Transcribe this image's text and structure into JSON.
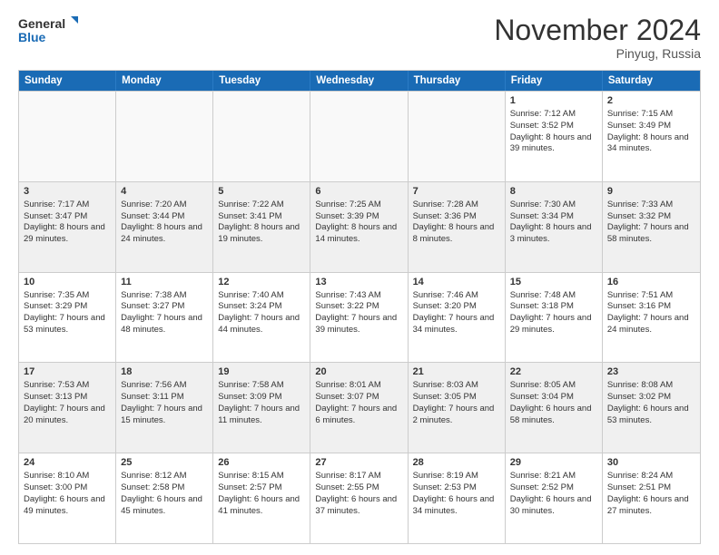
{
  "logo": {
    "line1": "General",
    "line2": "Blue"
  },
  "title": "November 2024",
  "location": "Pinyug, Russia",
  "headers": [
    "Sunday",
    "Monday",
    "Tuesday",
    "Wednesday",
    "Thursday",
    "Friday",
    "Saturday"
  ],
  "rows": [
    [
      {
        "day": "",
        "content": ""
      },
      {
        "day": "",
        "content": ""
      },
      {
        "day": "",
        "content": ""
      },
      {
        "day": "",
        "content": ""
      },
      {
        "day": "",
        "content": ""
      },
      {
        "day": "1",
        "content": "Sunrise: 7:12 AM\nSunset: 3:52 PM\nDaylight: 8 hours and 39 minutes."
      },
      {
        "day": "2",
        "content": "Sunrise: 7:15 AM\nSunset: 3:49 PM\nDaylight: 8 hours and 34 minutes."
      }
    ],
    [
      {
        "day": "3",
        "content": "Sunrise: 7:17 AM\nSunset: 3:47 PM\nDaylight: 8 hours and 29 minutes."
      },
      {
        "day": "4",
        "content": "Sunrise: 7:20 AM\nSunset: 3:44 PM\nDaylight: 8 hours and 24 minutes."
      },
      {
        "day": "5",
        "content": "Sunrise: 7:22 AM\nSunset: 3:41 PM\nDaylight: 8 hours and 19 minutes."
      },
      {
        "day": "6",
        "content": "Sunrise: 7:25 AM\nSunset: 3:39 PM\nDaylight: 8 hours and 14 minutes."
      },
      {
        "day": "7",
        "content": "Sunrise: 7:28 AM\nSunset: 3:36 PM\nDaylight: 8 hours and 8 minutes."
      },
      {
        "day": "8",
        "content": "Sunrise: 7:30 AM\nSunset: 3:34 PM\nDaylight: 8 hours and 3 minutes."
      },
      {
        "day": "9",
        "content": "Sunrise: 7:33 AM\nSunset: 3:32 PM\nDaylight: 7 hours and 58 minutes."
      }
    ],
    [
      {
        "day": "10",
        "content": "Sunrise: 7:35 AM\nSunset: 3:29 PM\nDaylight: 7 hours and 53 minutes."
      },
      {
        "day": "11",
        "content": "Sunrise: 7:38 AM\nSunset: 3:27 PM\nDaylight: 7 hours and 48 minutes."
      },
      {
        "day": "12",
        "content": "Sunrise: 7:40 AM\nSunset: 3:24 PM\nDaylight: 7 hours and 44 minutes."
      },
      {
        "day": "13",
        "content": "Sunrise: 7:43 AM\nSunset: 3:22 PM\nDaylight: 7 hours and 39 minutes."
      },
      {
        "day": "14",
        "content": "Sunrise: 7:46 AM\nSunset: 3:20 PM\nDaylight: 7 hours and 34 minutes."
      },
      {
        "day": "15",
        "content": "Sunrise: 7:48 AM\nSunset: 3:18 PM\nDaylight: 7 hours and 29 minutes."
      },
      {
        "day": "16",
        "content": "Sunrise: 7:51 AM\nSunset: 3:16 PM\nDaylight: 7 hours and 24 minutes."
      }
    ],
    [
      {
        "day": "17",
        "content": "Sunrise: 7:53 AM\nSunset: 3:13 PM\nDaylight: 7 hours and 20 minutes."
      },
      {
        "day": "18",
        "content": "Sunrise: 7:56 AM\nSunset: 3:11 PM\nDaylight: 7 hours and 15 minutes."
      },
      {
        "day": "19",
        "content": "Sunrise: 7:58 AM\nSunset: 3:09 PM\nDaylight: 7 hours and 11 minutes."
      },
      {
        "day": "20",
        "content": "Sunrise: 8:01 AM\nSunset: 3:07 PM\nDaylight: 7 hours and 6 minutes."
      },
      {
        "day": "21",
        "content": "Sunrise: 8:03 AM\nSunset: 3:05 PM\nDaylight: 7 hours and 2 minutes."
      },
      {
        "day": "22",
        "content": "Sunrise: 8:05 AM\nSunset: 3:04 PM\nDaylight: 6 hours and 58 minutes."
      },
      {
        "day": "23",
        "content": "Sunrise: 8:08 AM\nSunset: 3:02 PM\nDaylight: 6 hours and 53 minutes."
      }
    ],
    [
      {
        "day": "24",
        "content": "Sunrise: 8:10 AM\nSunset: 3:00 PM\nDaylight: 6 hours and 49 minutes."
      },
      {
        "day": "25",
        "content": "Sunrise: 8:12 AM\nSunset: 2:58 PM\nDaylight: 6 hours and 45 minutes."
      },
      {
        "day": "26",
        "content": "Sunrise: 8:15 AM\nSunset: 2:57 PM\nDaylight: 6 hours and 41 minutes."
      },
      {
        "day": "27",
        "content": "Sunrise: 8:17 AM\nSunset: 2:55 PM\nDaylight: 6 hours and 37 minutes."
      },
      {
        "day": "28",
        "content": "Sunrise: 8:19 AM\nSunset: 2:53 PM\nDaylight: 6 hours and 34 minutes."
      },
      {
        "day": "29",
        "content": "Sunrise: 8:21 AM\nSunset: 2:52 PM\nDaylight: 6 hours and 30 minutes."
      },
      {
        "day": "30",
        "content": "Sunrise: 8:24 AM\nSunset: 2:51 PM\nDaylight: 6 hours and 27 minutes."
      }
    ]
  ]
}
